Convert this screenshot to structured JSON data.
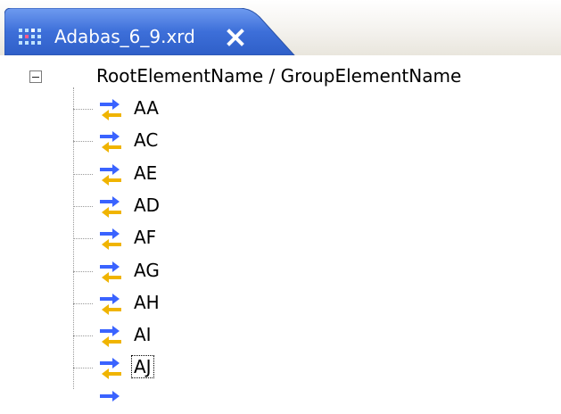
{
  "editor": {
    "tab": {
      "title": "Adabas_6_9.xrd",
      "icon": "xml-grid-icon",
      "close_icon": "close-icon",
      "color": "#3a6fd8"
    }
  },
  "tree": {
    "root_label": "RootElementName / GroupElementName",
    "expander_state": "expanded",
    "item_icon": "mapping-arrows-icon",
    "items": [
      {
        "label": "AA"
      },
      {
        "label": "AC"
      },
      {
        "label": "AE"
      },
      {
        "label": "AD"
      },
      {
        "label": "AF"
      },
      {
        "label": "AG"
      },
      {
        "label": "AH"
      },
      {
        "label": "AI"
      },
      {
        "label": "AJ"
      }
    ],
    "focused_item": "AJ"
  }
}
